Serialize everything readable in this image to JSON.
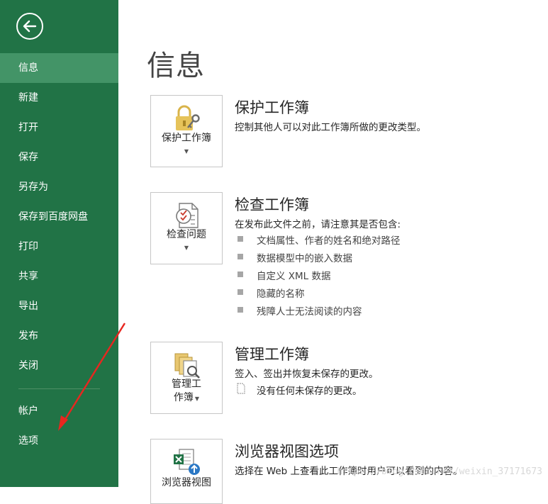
{
  "sidebar": {
    "back_icon": "back-arrow-icon",
    "items": [
      {
        "label": "信息",
        "active": true
      },
      {
        "label": "新建"
      },
      {
        "label": "打开"
      },
      {
        "label": "保存"
      },
      {
        "label": "另存为"
      },
      {
        "label": "保存到百度网盘"
      },
      {
        "label": "打印"
      },
      {
        "label": "共享"
      },
      {
        "label": "导出"
      },
      {
        "label": "发布"
      },
      {
        "label": "关闭"
      }
    ],
    "bottom_items": [
      {
        "label": "帐户"
      },
      {
        "label": "选项"
      }
    ],
    "bg_color": "#217346",
    "active_color": "#439467"
  },
  "main": {
    "title": "信息",
    "protect": {
      "button_label": "保护工作簿",
      "icon": "lock-key-icon",
      "title": "保护工作簿",
      "desc": "控制其他人可以对此工作簿所做的更改类型。"
    },
    "inspect": {
      "button_label": "检查问题",
      "icon": "inspect-document-icon",
      "title": "检查工作簿",
      "desc": "在发布此文件之前，请注意其是否包含:",
      "bullets": [
        "文档属性、作者的姓名和绝对路径",
        "数据模型中的嵌入数据",
        "自定义 XML 数据",
        "隐藏的名称",
        "残障人士无法阅读的内容"
      ]
    },
    "manage": {
      "button_label_line1": "管理工",
      "button_label_line2": "作簿",
      "icon": "manage-workbook-icon",
      "title": "管理工作簿",
      "desc": "签入、签出并恢复未保存的更改。",
      "note": "没有任何未保存的更改。",
      "note_icon": "document-icon"
    },
    "browser": {
      "button_label": "浏览器视图",
      "icon": "excel-upload-icon",
      "title": "浏览器视图选项",
      "desc": "选择在 Web 上查看此工作簿时用户可以看到的内容。"
    }
  },
  "watermark": "https://blog.csdn.net/weixin_37171673",
  "annotation": {
    "color": "#e8261f"
  }
}
